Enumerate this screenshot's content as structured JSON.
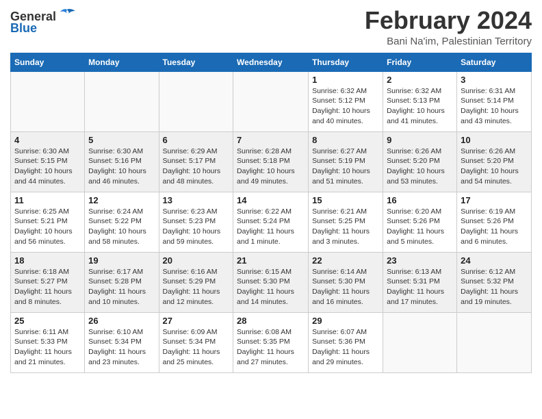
{
  "header": {
    "logo_general": "General",
    "logo_blue": "Blue",
    "month_title": "February 2024",
    "location": "Bani Na'im, Palestinian Territory"
  },
  "columns": [
    "Sunday",
    "Monday",
    "Tuesday",
    "Wednesday",
    "Thursday",
    "Friday",
    "Saturday"
  ],
  "weeks": [
    [
      {
        "day": "",
        "info": ""
      },
      {
        "day": "",
        "info": ""
      },
      {
        "day": "",
        "info": ""
      },
      {
        "day": "",
        "info": ""
      },
      {
        "day": "1",
        "info": "Sunrise: 6:32 AM\nSunset: 5:12 PM\nDaylight: 10 hours and 40 minutes."
      },
      {
        "day": "2",
        "info": "Sunrise: 6:32 AM\nSunset: 5:13 PM\nDaylight: 10 hours and 41 minutes."
      },
      {
        "day": "3",
        "info": "Sunrise: 6:31 AM\nSunset: 5:14 PM\nDaylight: 10 hours and 43 minutes."
      }
    ],
    [
      {
        "day": "4",
        "info": "Sunrise: 6:30 AM\nSunset: 5:15 PM\nDaylight: 10 hours and 44 minutes."
      },
      {
        "day": "5",
        "info": "Sunrise: 6:30 AM\nSunset: 5:16 PM\nDaylight: 10 hours and 46 minutes."
      },
      {
        "day": "6",
        "info": "Sunrise: 6:29 AM\nSunset: 5:17 PM\nDaylight: 10 hours and 48 minutes."
      },
      {
        "day": "7",
        "info": "Sunrise: 6:28 AM\nSunset: 5:18 PM\nDaylight: 10 hours and 49 minutes."
      },
      {
        "day": "8",
        "info": "Sunrise: 6:27 AM\nSunset: 5:19 PM\nDaylight: 10 hours and 51 minutes."
      },
      {
        "day": "9",
        "info": "Sunrise: 6:26 AM\nSunset: 5:20 PM\nDaylight: 10 hours and 53 minutes."
      },
      {
        "day": "10",
        "info": "Sunrise: 6:26 AM\nSunset: 5:20 PM\nDaylight: 10 hours and 54 minutes."
      }
    ],
    [
      {
        "day": "11",
        "info": "Sunrise: 6:25 AM\nSunset: 5:21 PM\nDaylight: 10 hours and 56 minutes."
      },
      {
        "day": "12",
        "info": "Sunrise: 6:24 AM\nSunset: 5:22 PM\nDaylight: 10 hours and 58 minutes."
      },
      {
        "day": "13",
        "info": "Sunrise: 6:23 AM\nSunset: 5:23 PM\nDaylight: 10 hours and 59 minutes."
      },
      {
        "day": "14",
        "info": "Sunrise: 6:22 AM\nSunset: 5:24 PM\nDaylight: 11 hours and 1 minute."
      },
      {
        "day": "15",
        "info": "Sunrise: 6:21 AM\nSunset: 5:25 PM\nDaylight: 11 hours and 3 minutes."
      },
      {
        "day": "16",
        "info": "Sunrise: 6:20 AM\nSunset: 5:26 PM\nDaylight: 11 hours and 5 minutes."
      },
      {
        "day": "17",
        "info": "Sunrise: 6:19 AM\nSunset: 5:26 PM\nDaylight: 11 hours and 6 minutes."
      }
    ],
    [
      {
        "day": "18",
        "info": "Sunrise: 6:18 AM\nSunset: 5:27 PM\nDaylight: 11 hours and 8 minutes."
      },
      {
        "day": "19",
        "info": "Sunrise: 6:17 AM\nSunset: 5:28 PM\nDaylight: 11 hours and 10 minutes."
      },
      {
        "day": "20",
        "info": "Sunrise: 6:16 AM\nSunset: 5:29 PM\nDaylight: 11 hours and 12 minutes."
      },
      {
        "day": "21",
        "info": "Sunrise: 6:15 AM\nSunset: 5:30 PM\nDaylight: 11 hours and 14 minutes."
      },
      {
        "day": "22",
        "info": "Sunrise: 6:14 AM\nSunset: 5:30 PM\nDaylight: 11 hours and 16 minutes."
      },
      {
        "day": "23",
        "info": "Sunrise: 6:13 AM\nSunset: 5:31 PM\nDaylight: 11 hours and 17 minutes."
      },
      {
        "day": "24",
        "info": "Sunrise: 6:12 AM\nSunset: 5:32 PM\nDaylight: 11 hours and 19 minutes."
      }
    ],
    [
      {
        "day": "25",
        "info": "Sunrise: 6:11 AM\nSunset: 5:33 PM\nDaylight: 11 hours and 21 minutes."
      },
      {
        "day": "26",
        "info": "Sunrise: 6:10 AM\nSunset: 5:34 PM\nDaylight: 11 hours and 23 minutes."
      },
      {
        "day": "27",
        "info": "Sunrise: 6:09 AM\nSunset: 5:34 PM\nDaylight: 11 hours and 25 minutes."
      },
      {
        "day": "28",
        "info": "Sunrise: 6:08 AM\nSunset: 5:35 PM\nDaylight: 11 hours and 27 minutes."
      },
      {
        "day": "29",
        "info": "Sunrise: 6:07 AM\nSunset: 5:36 PM\nDaylight: 11 hours and 29 minutes."
      },
      {
        "day": "",
        "info": ""
      },
      {
        "day": "",
        "info": ""
      }
    ]
  ]
}
